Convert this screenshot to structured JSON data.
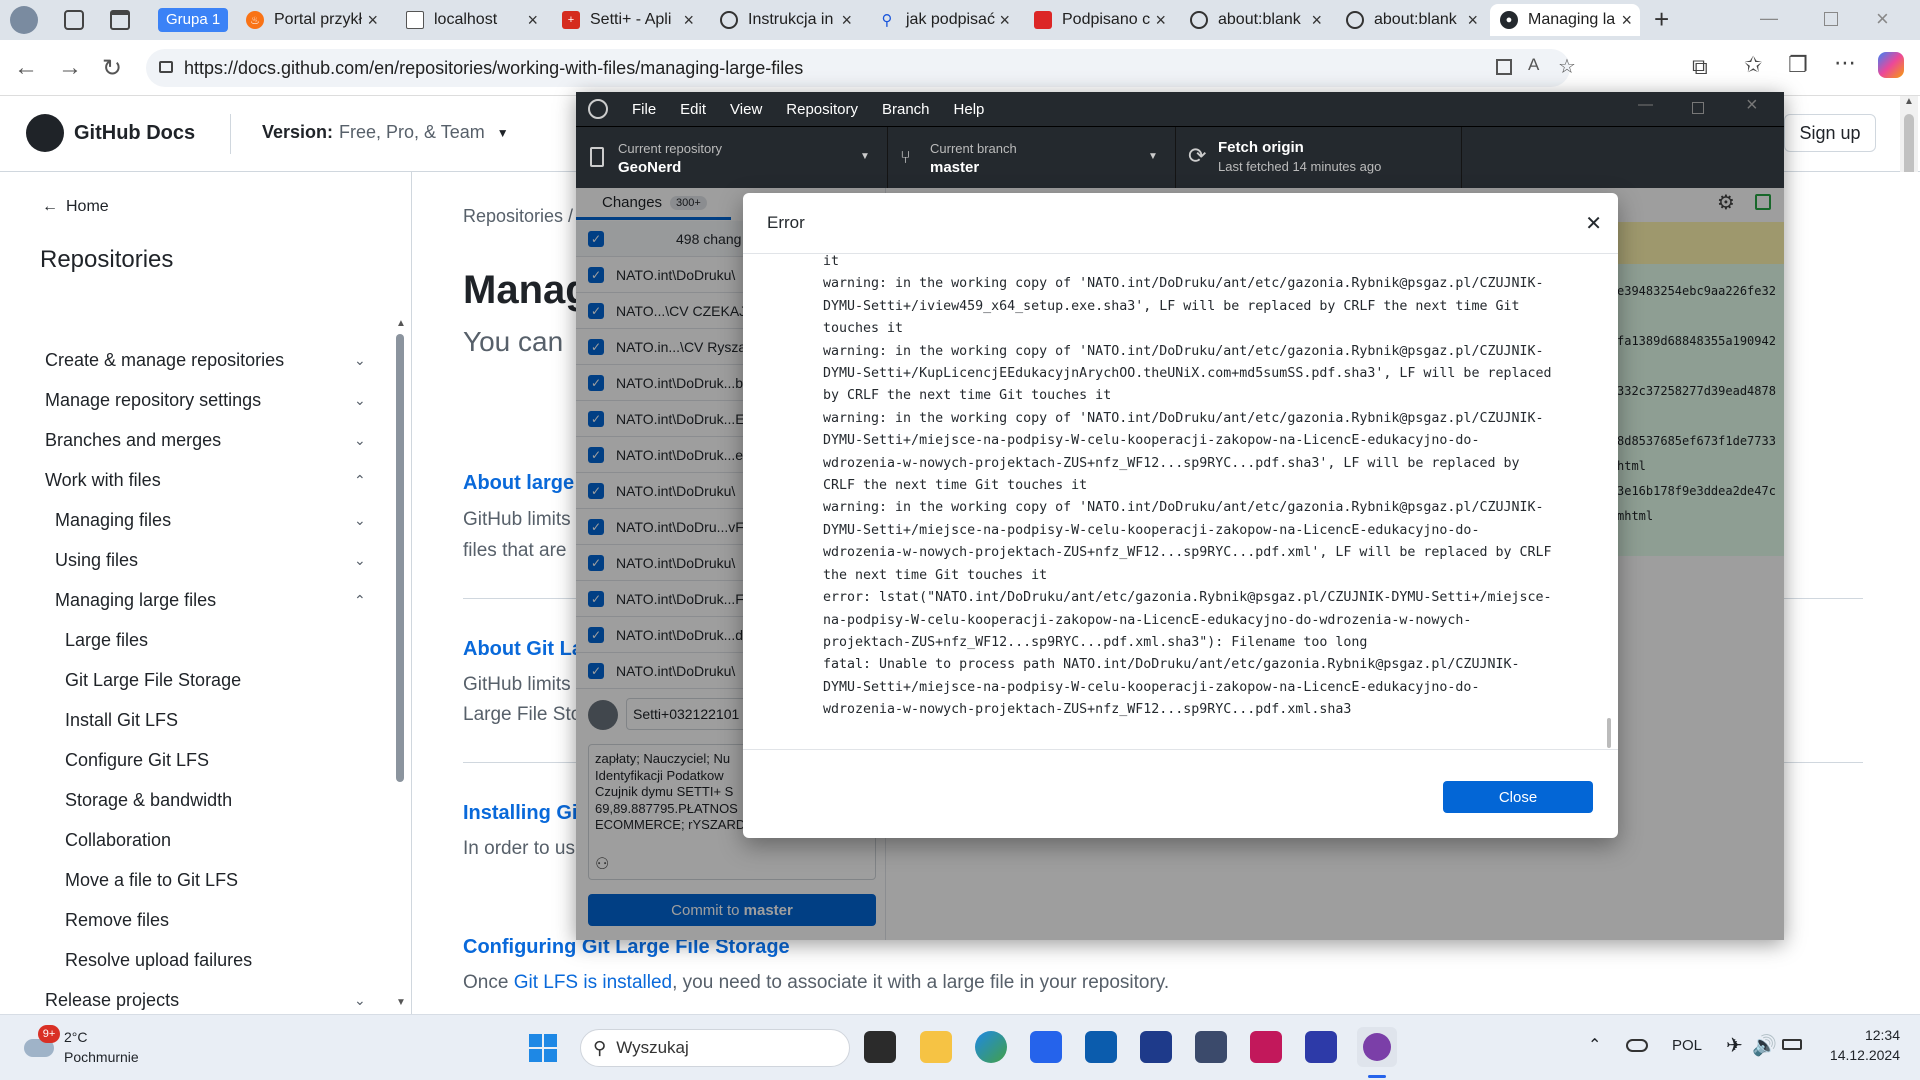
{
  "browser": {
    "tab_group": "Grupa 1",
    "tabs": [
      {
        "title": "Portal przykł",
        "icon": "flame-icon"
      },
      {
        "title": "localhost",
        "icon": "page-icon"
      },
      {
        "title": "Setti+ - Apli",
        "icon": "swiss-flag-icon"
      },
      {
        "title": "Instrukcja in",
        "icon": "globe-icon"
      },
      {
        "title": "jak podpisać",
        "icon": "search-icon"
      },
      {
        "title": "Podpisano c",
        "icon": "pl-emblem-icon"
      },
      {
        "title": "about:blank",
        "icon": "globe-icon"
      },
      {
        "title": "about:blank",
        "icon": "globe-icon"
      },
      {
        "title": "Managing la",
        "icon": "github-icon"
      }
    ],
    "url": "https://docs.github.com/en/repositories/working-with-files/managing-large-files"
  },
  "docs": {
    "logo_text": "GitHub Docs",
    "version_label": "Version:",
    "version_value": "Free, Pro, & Team",
    "signup": "Sign up",
    "home": "Home",
    "section_title": "Repositories",
    "sidebar": [
      "Create & manage repositories",
      "Manage repository settings",
      "Branches and merges",
      "Work with files",
      "Managing files",
      "Using files",
      "Managing large files",
      "Large files",
      "Git Large File Storage",
      "Install Git LFS",
      "Configure Git LFS",
      "Storage & bandwidth",
      "Collaboration",
      "Move a file to Git LFS",
      "Remove files",
      "Resolve upload failures",
      "Release projects"
    ],
    "breadcrumb": "Repositories",
    "page_title": "Manag",
    "intro": "You can",
    "sections": [
      {
        "heading": "About large",
        "lines": [
          "GitHub limits",
          "files that are"
        ]
      },
      {
        "heading": "About Git La",
        "lines": [
          "GitHub limits",
          "Large File Sto"
        ]
      },
      {
        "heading": "Installing Git",
        "lines": [
          "In order to us"
        ]
      }
    ],
    "configuring_heading": "Configuring Git Large File Storage",
    "configuring_text_1": "Once ",
    "configuring_link": "Git LFS is installed",
    "configuring_text_2": ", you need to associate it with a large file in your repository."
  },
  "app": {
    "menu": [
      "File",
      "Edit",
      "View",
      "Repository",
      "Branch",
      "Help"
    ],
    "current_repo_label": "Current repository",
    "current_repo": "GeoNerd",
    "current_branch_label": "Current branch",
    "current_branch": "master",
    "fetch_label": "Fetch origin",
    "fetch_sub": "Last fetched 14 minutes ago",
    "tab_changes": "Changes",
    "changes_count": "300+",
    "changed_files": "498 chang",
    "files": [
      "NATO.int\\DoDruku\\",
      "NATO...\\CV CZEKAJ",
      "NATO.in...\\CV Rysza",
      "NATO.int\\DoDruk...b",
      "NATO.int\\DoDruk...E",
      "NATO.int\\DoDruk...e",
      "NATO.int\\DoDruku\\",
      "NATO.int\\DoDru...vF",
      "NATO.int\\DoDruku\\",
      "NATO.int\\DoDruk...F",
      "NATO.int\\DoDruk...d",
      "NATO.int\\DoDruku\\"
    ],
    "summary_value": "Setti+032122101",
    "description": [
      "zapłaty; Nauczyciel; Nu",
      "Identyfikacji Podatkow",
      "Czujnik dymu SETTI+ S",
      "69,89.887795.PŁATNOS",
      "ECOMMERCE; rYSZARD Czekaj; NIP:"
    ],
    "commit_prefix": "Commit to ",
    "commit_branch": "master",
    "hashes": [
      "e39483254ebc9aa226fe32",
      "fa1389d68848355a190942",
      "332c37258277d39ead4878",
      "8d8537685ef673f1de7733",
      "html",
      "3e16b178f9e3ddea2de47c",
      "mhtml"
    ]
  },
  "dialog": {
    "title": "Error",
    "close_label": "Close",
    "lines": [
      "it",
      "warning: in the working copy of 'NATO.int/DoDruku/ant/etc/gazonia.Rybnik@psgaz.pl/CZUJNIK-",
      "DYMU-Setti+/iview459_x64_setup.exe.sha3', LF will be replaced by CRLF the next time Git",
      "touches it",
      "warning: in the working copy of 'NATO.int/DoDruku/ant/etc/gazonia.Rybnik@psgaz.pl/CZUJNIK-",
      "DYMU-Setti+/KupLicencjEEdukacyjnArychOO.theUNiX.com+md5sumSS.pdf.sha3', LF will be replaced",
      "by CRLF the next time Git touches it",
      "warning: in the working copy of 'NATO.int/DoDruku/ant/etc/gazonia.Rybnik@psgaz.pl/CZUJNIK-",
      "DYMU-Setti+/miejsce-na-podpisy-W-celu-kooperacji-zakopow-na-LicencE-edukacyjno-do-",
      "wdrozenia-w-nowych-projektach-ZUS+nfz_WF12...sp9RYC...pdf.sha3', LF will be replaced by",
      "CRLF the next time Git touches it",
      "warning: in the working copy of 'NATO.int/DoDruku/ant/etc/gazonia.Rybnik@psgaz.pl/CZUJNIK-",
      "DYMU-Setti+/miejsce-na-podpisy-W-celu-kooperacji-zakopow-na-LicencE-edukacyjno-do-",
      "wdrozenia-w-nowych-projektach-ZUS+nfz_WF12...sp9RYC...pdf.xml', LF will be replaced by CRLF",
      "the next time Git touches it",
      "error: lstat(\"NATO.int/DoDruku/ant/etc/gazonia.Rybnik@psgaz.pl/CZUJNIK-DYMU-Setti+/miejsce-",
      "na-podpisy-W-celu-kooperacji-zakopow-na-LicencE-edukacyjno-do-wdrozenia-w-nowych-",
      "projektach-ZUS+nfz_WF12...sp9RYC...pdf.xml.sha3\"): Filename too long",
      "fatal: Unable to process path NATO.int/DoDruku/ant/etc/gazonia.Rybnik@psgaz.pl/CZUJNIK-",
      "DYMU-Setti+/miejsce-na-podpisy-W-celu-kooperacji-zakopow-na-LicencE-edukacyjno-do-",
      "wdrozenia-w-nowych-projektach-ZUS+nfz_WF12...sp9RYC...pdf.xml.sha3"
    ]
  },
  "taskbar": {
    "weather_temp": "2°C",
    "weather_desc": "Pochmurnie",
    "weather_badge": "9+",
    "search_placeholder": "Wyszukaj",
    "lang": "POL",
    "time": "12:34",
    "date": "14.12.2024",
    "colors": {
      "accent": "#0366d6",
      "taskbar": "#e9eef5"
    }
  }
}
